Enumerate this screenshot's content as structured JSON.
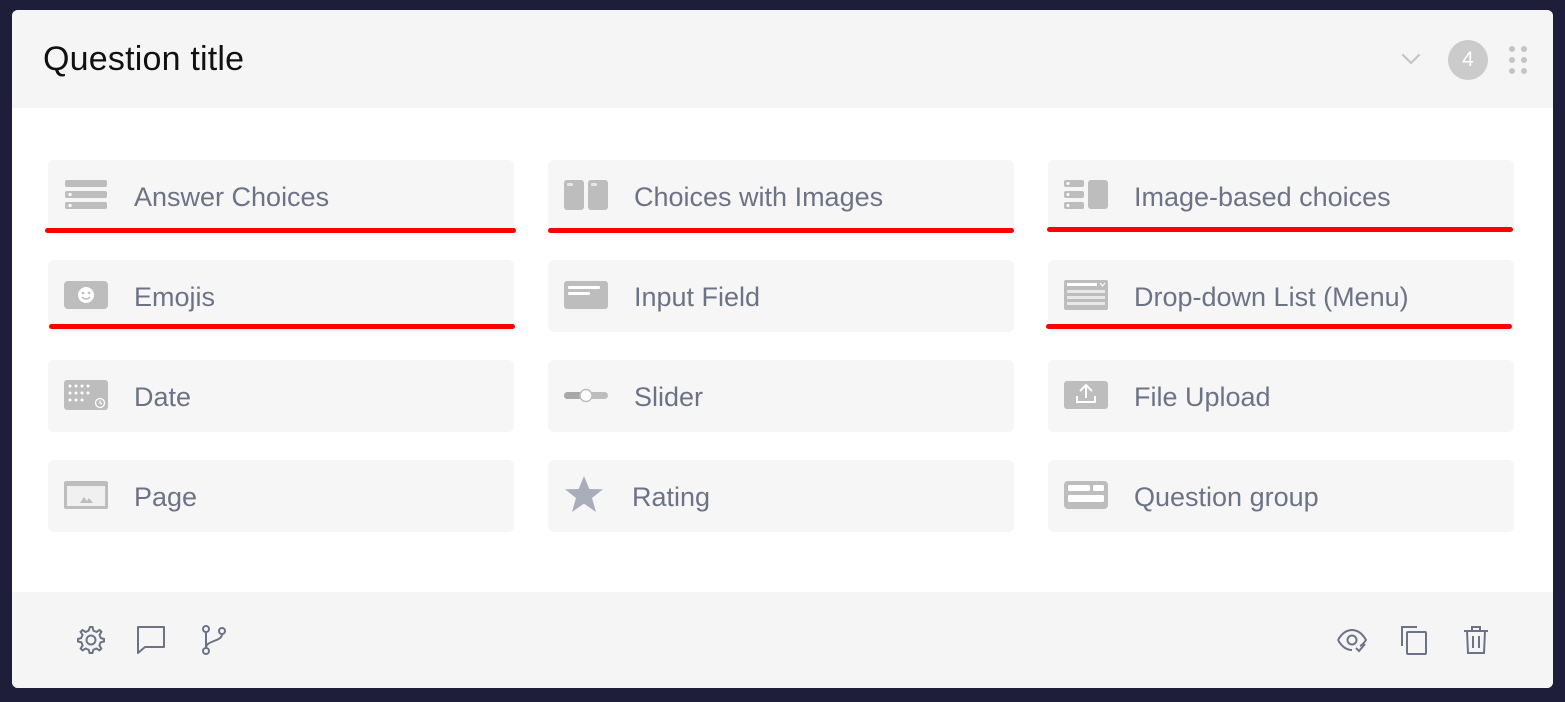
{
  "header": {
    "title": "Question title",
    "badge_count": "4",
    "icons": {
      "collapse": "chevron-down-icon",
      "drag": "drag-handle-icon"
    }
  },
  "question_types": [
    {
      "label": "Answer Choices",
      "icon": "list-icon",
      "underlined": true
    },
    {
      "label": "Choices with Images",
      "icon": "image-cards-icon",
      "underlined": true
    },
    {
      "label": "Image-based choices",
      "icon": "list-image-icon",
      "underlined": true
    },
    {
      "label": "Emojis",
      "icon": "emoji-icon",
      "underlined": true
    },
    {
      "label": "Input Field",
      "icon": "input-field-icon",
      "underlined": false
    },
    {
      "label": "Drop-down List (Menu)",
      "icon": "dropdown-list-icon",
      "underlined": true
    },
    {
      "label": "Date",
      "icon": "calendar-icon",
      "underlined": false
    },
    {
      "label": "Slider",
      "icon": "slider-icon",
      "underlined": false
    },
    {
      "label": "File Upload",
      "icon": "upload-icon",
      "underlined": false
    },
    {
      "label": "Page",
      "icon": "page-icon",
      "underlined": false
    },
    {
      "label": "Rating",
      "icon": "star-icon",
      "underlined": false
    },
    {
      "label": "Question group",
      "icon": "group-icon",
      "underlined": false
    }
  ],
  "footer": {
    "left_icons": [
      "settings-icon",
      "comment-icon",
      "branch-icon"
    ],
    "right_icons": [
      "preview-icon",
      "copy-icon",
      "delete-icon"
    ]
  },
  "colors": {
    "background": "#1e1e3a",
    "tile": "#f6f6f6",
    "tile_text": "#6d7387",
    "icon_gray": "#bdbdbd",
    "underline": "#ff0000",
    "footer_icon": "#6d7387"
  }
}
